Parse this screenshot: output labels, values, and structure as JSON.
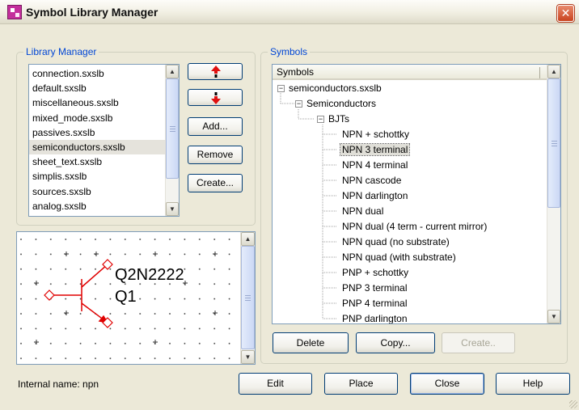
{
  "window": {
    "title": "Symbol Library Manager",
    "close_glyph": "✕"
  },
  "library_manager": {
    "legend": "Library Manager",
    "items": [
      "connection.sxslb",
      "default.sxslb",
      "miscellaneous.sxslb",
      "mixed_mode.sxslb",
      "passives.sxslb",
      "semiconductors.sxslb",
      "sheet_text.sxslb",
      "simplis.sxslb",
      "sources.sxslb",
      "analog.sxslb"
    ],
    "selected_index": 5,
    "buttons": {
      "add": "Add...",
      "remove": "Remove",
      "create": "Create..."
    }
  },
  "preview": {
    "part_name": "Q2N2222",
    "ref_designator": "Q1"
  },
  "status": {
    "internal_name": "Internal name: npn"
  },
  "symbols": {
    "legend": "Symbols",
    "column_header": "Symbols",
    "tree": {
      "library": "semiconductors.sxslb",
      "category": "Semiconductors",
      "group": "BJTs",
      "items": [
        "NPN + schottky",
        "NPN 3 terminal",
        "NPN 4 terminal",
        "NPN cascode",
        "NPN darlington",
        "NPN dual",
        "NPN dual (4 term - current mirror)",
        "NPN quad (no substrate)",
        "NPN quad (with substrate)",
        "PNP + schottky",
        "PNP 3 terminal",
        "PNP 4 terminal",
        "PNP darlington"
      ],
      "selected_index": 1
    },
    "buttons": {
      "delete": "Delete",
      "copy": "Copy...",
      "create": "Create.."
    }
  },
  "bottom_buttons": {
    "edit": "Edit",
    "place": "Place",
    "close": "Close",
    "help": "Help"
  },
  "colors": {
    "accent": "#0046d5",
    "move_arrows": "#e01010",
    "schematic_wire": "#e00000"
  },
  "icons": {
    "app": "symbol-library-icon",
    "move_up": "red-up-arrow",
    "move_down": "red-down-arrow"
  }
}
